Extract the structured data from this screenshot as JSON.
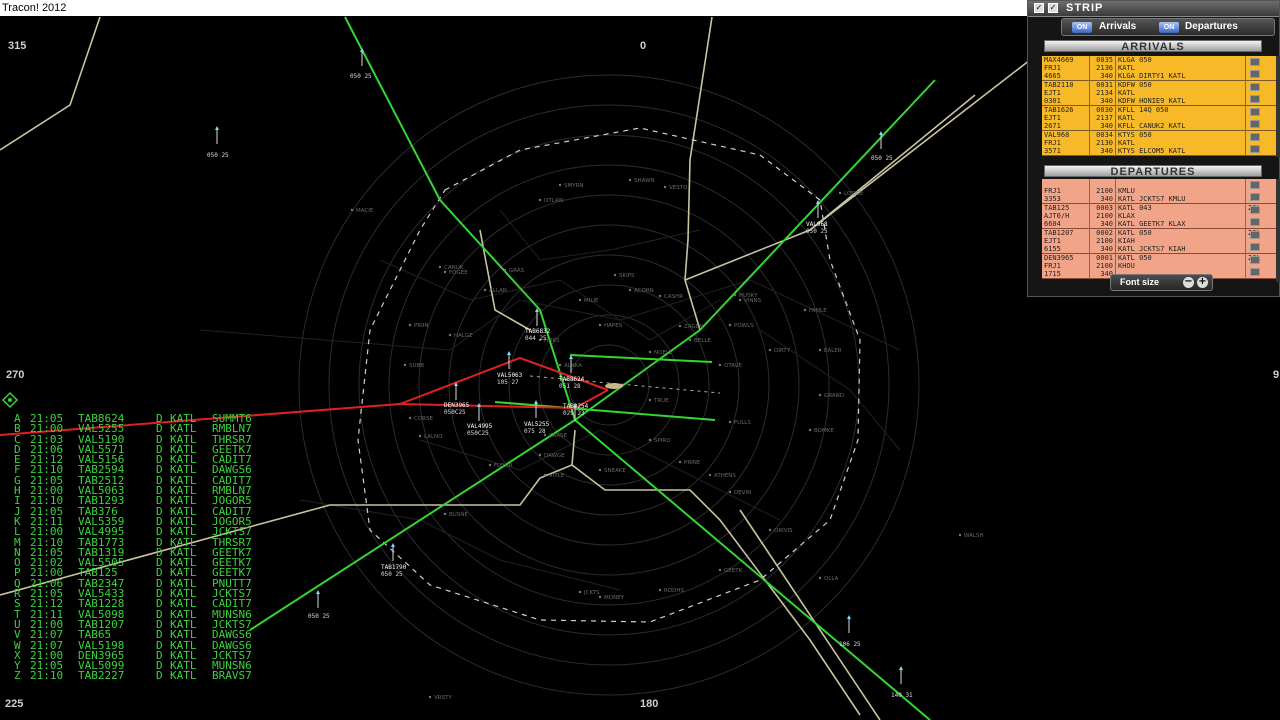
{
  "window": {
    "title": "Tracon! 2012"
  },
  "bearings": {
    "b315": "315",
    "b0": "0",
    "b270": "270",
    "b90": "9",
    "b225": "225",
    "b180": "180"
  },
  "fixes": [
    "SMYRN",
    "SHAWN",
    "VESTO",
    "OTLAW",
    "LODGE",
    "MACIE",
    "CANUK",
    "FOGEE",
    "GRAS",
    "SKIPS",
    "ALLAN",
    "MILIE",
    "ACORN",
    "CASHR",
    "HUSKY",
    "VINNS",
    "PRIIN",
    "HAPES",
    "ZAGEN",
    "POWLS",
    "FAMLE",
    "HALGE",
    "HOKS",
    "BELLE",
    "DIRTY",
    "EALER",
    "SUBB",
    "NOELE",
    "ALAKA",
    "OTAVE",
    "GRAND",
    "CORSE",
    "TRUE",
    "FULLS",
    "BOMKE",
    "LALNO",
    "KRASE",
    "SPIRO",
    "FLOOR",
    "DAWGE",
    "PRINE",
    "ATHENS",
    "DEVIN",
    "BUSNE",
    "VITLE",
    "SNEAKE",
    "ORIVIS",
    "OLLA",
    "JCKTS",
    "MONEY",
    "GEETK",
    "RODHS",
    "VRSTY",
    "WALSH"
  ],
  "aircraft": [
    {
      "id": "TAB6832",
      "alt": "044 25"
    },
    {
      "id": "VAL5063",
      "alt": "105 27"
    },
    {
      "id": "TAB8624",
      "alt": "051 28"
    },
    {
      "id": "DEN3965",
      "alt": "050C25"
    },
    {
      "id": "VAL4995",
      "alt": "050C25"
    },
    {
      "id": "VAL5255",
      "alt": "075 28"
    },
    {
      "id": "TAB2254",
      "alt": "029 23"
    },
    {
      "id": "VAL968",
      "alt": "050 25"
    },
    {
      "id": "TAB1790",
      "alt": "050 25"
    },
    {
      "id": "",
      "alt": "050 25",
      "key": "nw1"
    },
    {
      "id": "",
      "alt": "050 25",
      "key": "nw2"
    },
    {
      "id": "",
      "alt": "050 25",
      "key": "ne1"
    },
    {
      "id": "",
      "alt": "050 25",
      "key": "sw1"
    },
    {
      "id": "",
      "alt": "106 25",
      "key": "se1"
    },
    {
      "id": "",
      "alt": "140 31",
      "key": "se2"
    }
  ],
  "command_list": [
    [
      "A",
      "21:05",
      "TAB8624",
      "D",
      "KATL",
      "SUMMT6"
    ],
    [
      "B",
      "21:00",
      "VAL5255",
      "D",
      "KATL",
      "RMBLN7"
    ],
    [
      "C",
      "21:03",
      "VAL5190",
      "D",
      "KATL",
      "THRSR7"
    ],
    [
      "D",
      "21:06",
      "VAL5571",
      "D",
      "KATL",
      "GEETK7"
    ],
    [
      "E",
      "21:12",
      "VAL5156",
      "D",
      "KATL",
      "CADIT7"
    ],
    [
      "F",
      "21:10",
      "TAB2594",
      "D",
      "KATL",
      "DAWGS6"
    ],
    [
      "G",
      "21:05",
      "TAB2512",
      "D",
      "KATL",
      "CADIT7"
    ],
    [
      "H",
      "21:00",
      "VAL5063",
      "D",
      "KATL",
      "RMBLN7"
    ],
    [
      "I",
      "21:10",
      "TAB1293",
      "D",
      "KATL",
      "JOGOR5"
    ],
    [
      "J",
      "21:05",
      "TAB376",
      "D",
      "KATL",
      "CADIT7"
    ],
    [
      "K",
      "21:11",
      "VAL5359",
      "D",
      "KATL",
      "JOGOR5"
    ],
    [
      "L",
      "21:00",
      "VAL4995",
      "D",
      "KATL",
      "JCKTS7"
    ],
    [
      "M",
      "21:10",
      "TAB1773",
      "D",
      "KATL",
      "THRSR7"
    ],
    [
      "N",
      "21:05",
      "TAB1319",
      "D",
      "KATL",
      "GEETK7"
    ],
    [
      "O",
      "21:02",
      "VAL5505",
      "D",
      "KATL",
      "GEETK7"
    ],
    [
      "P",
      "21:00",
      "TAB125",
      "D",
      "KATL",
      "GEETK7"
    ],
    [
      "Q",
      "21:06",
      "TAB2347",
      "D",
      "KATL",
      "PNUTT7"
    ],
    [
      "R",
      "21:05",
      "VAL5433",
      "D",
      "KATL",
      "JCKTS7"
    ],
    [
      "S",
      "21:12",
      "TAB1228",
      "D",
      "KATL",
      "CADIT7"
    ],
    [
      "T",
      "21:11",
      "VAL5098",
      "D",
      "KATL",
      "MUNSN6"
    ],
    [
      "U",
      "21:00",
      "TAB1207",
      "D",
      "KATL",
      "JCKTS7"
    ],
    [
      "V",
      "21:07",
      "TAB65",
      "D",
      "KATL",
      "DAWGS6"
    ],
    [
      "W",
      "21:07",
      "VAL5198",
      "D",
      "KATL",
      "DAWGS6"
    ],
    [
      "X",
      "21:00",
      "DEN3965",
      "D",
      "KATL",
      "JCKTS7"
    ],
    [
      "Y",
      "21:05",
      "VAL5099",
      "D",
      "KATL",
      "MUNSN6"
    ],
    [
      "Z",
      "21:10",
      "TAB2227",
      "D",
      "KATL",
      "BRAVS7"
    ]
  ],
  "strip": {
    "title": "STRIP",
    "on_label": "ON",
    "arrivals_label": "Arrivals",
    "departures_label": "Departures",
    "arrivals_header": "ARRIVALS",
    "departures_header": "DEPARTURES",
    "arrivals": [
      {
        "c1": [
          "MAX4669",
          "FRJ1",
          "4665"
        ],
        "c2": [
          "0035",
          "2136",
          "340"
        ],
        "c3": [
          "KLGA 050",
          "KATL",
          "KLGA DIRTY1 KATL"
        ],
        "c4": ""
      },
      {
        "c1": [
          "TAB2110",
          "EJT1",
          "0301"
        ],
        "c2": [
          "0031",
          "2134",
          "340"
        ],
        "c3": [
          "KDFW 050",
          "KATL",
          "KDFW HONIE9 KATL"
        ],
        "c4": ""
      },
      {
        "c1": [
          "TAB1626",
          "EJT1",
          "2671"
        ],
        "c2": [
          "0030",
          "2137",
          "340"
        ],
        "c3": [
          "KFLL 14Q 050",
          "KATL",
          "KFLL CANUK2 KATL"
        ],
        "c4": ""
      },
      {
        "c1": [
          "VAL968",
          "FRJ1",
          "3571"
        ],
        "c2": [
          "0034",
          "2130",
          "340"
        ],
        "c3": [
          "KTYS 050",
          "KATL",
          "KTYS ELCOM5 KATL"
        ],
        "c4": ""
      }
    ],
    "departures": [
      {
        "c1": [
          "",
          "FRJ1",
          "3353"
        ],
        "c2": [
          "",
          "2100",
          "340"
        ],
        "c3": [
          "",
          "KMLU",
          "KATL JCKTS7 KMLU"
        ],
        "c4": ""
      },
      {
        "c1": [
          "TAB125",
          "AJT0/H",
          "6604"
        ],
        "c2": [
          "0003",
          "2100",
          "340"
        ],
        "c3": [
          "KATL 043",
          "KLAX",
          "KATL GEETK7 KLAX"
        ],
        "c4": "26L"
      },
      {
        "c1": [
          "TAB1207",
          "EJT1",
          "6155"
        ],
        "c2": [
          "0002",
          "2100",
          "340"
        ],
        "c3": [
          "KATL 050",
          "KIAH",
          "KATL JCKTS7 KIAH"
        ],
        "c4": "26L"
      },
      {
        "c1": [
          "DEN3965",
          "FRJ1",
          "1715"
        ],
        "c2": [
          "0001",
          "2100",
          "340"
        ],
        "c3": [
          "KATL 050",
          "KHOU",
          ""
        ],
        "c4": "26L"
      }
    ],
    "font_size_label": "Font size",
    "minus": "−",
    "plus": "+",
    "close_glyph": "✓"
  }
}
